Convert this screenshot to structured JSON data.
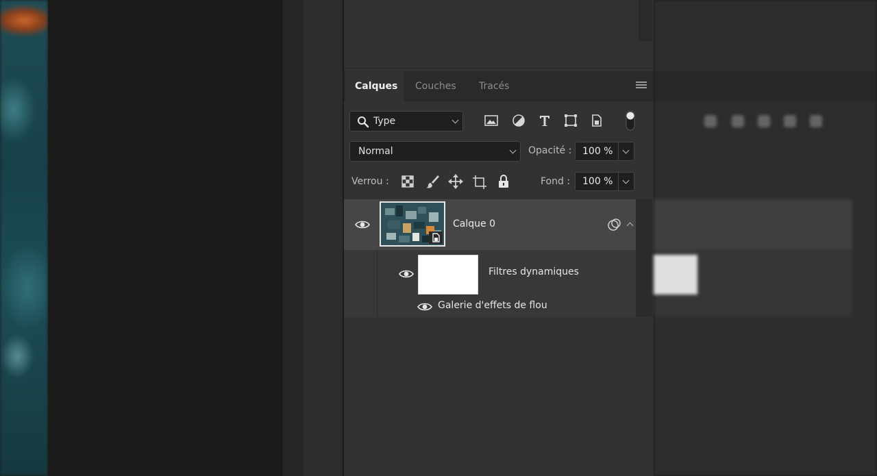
{
  "layers_panel": {
    "tabs": [
      {
        "label": "Calques",
        "active": true
      },
      {
        "label": "Couches",
        "active": false
      },
      {
        "label": "Tracés",
        "active": false
      }
    ],
    "filter": {
      "kind_label": "Type",
      "icons": [
        "image-filter-icon",
        "adjustment-filter-icon",
        "type-filter-icon",
        "shape-filter-icon",
        "smart-object-filter-icon",
        "filter-toggle-icon"
      ]
    },
    "blend": {
      "mode": "Normal",
      "opacity_label": "Opacité :",
      "opacity_value": "100 %"
    },
    "lock": {
      "label": "Verrou :",
      "icons": [
        "lock-transparent-pixels-icon",
        "lock-image-pixels-icon",
        "lock-position-icon",
        "lock-artboard-icon",
        "lock-all-icon"
      ],
      "fill_label": "Fond :",
      "fill_value": "100 %"
    },
    "layers": [
      {
        "name": "Calque 0",
        "visible": true,
        "smart_object": true,
        "smart_filters": {
          "label": "Filtres dynamiques",
          "visible": true,
          "filters": [
            {
              "name": "Galerie d'effets de flou",
              "visible": true
            }
          ]
        }
      }
    ]
  }
}
